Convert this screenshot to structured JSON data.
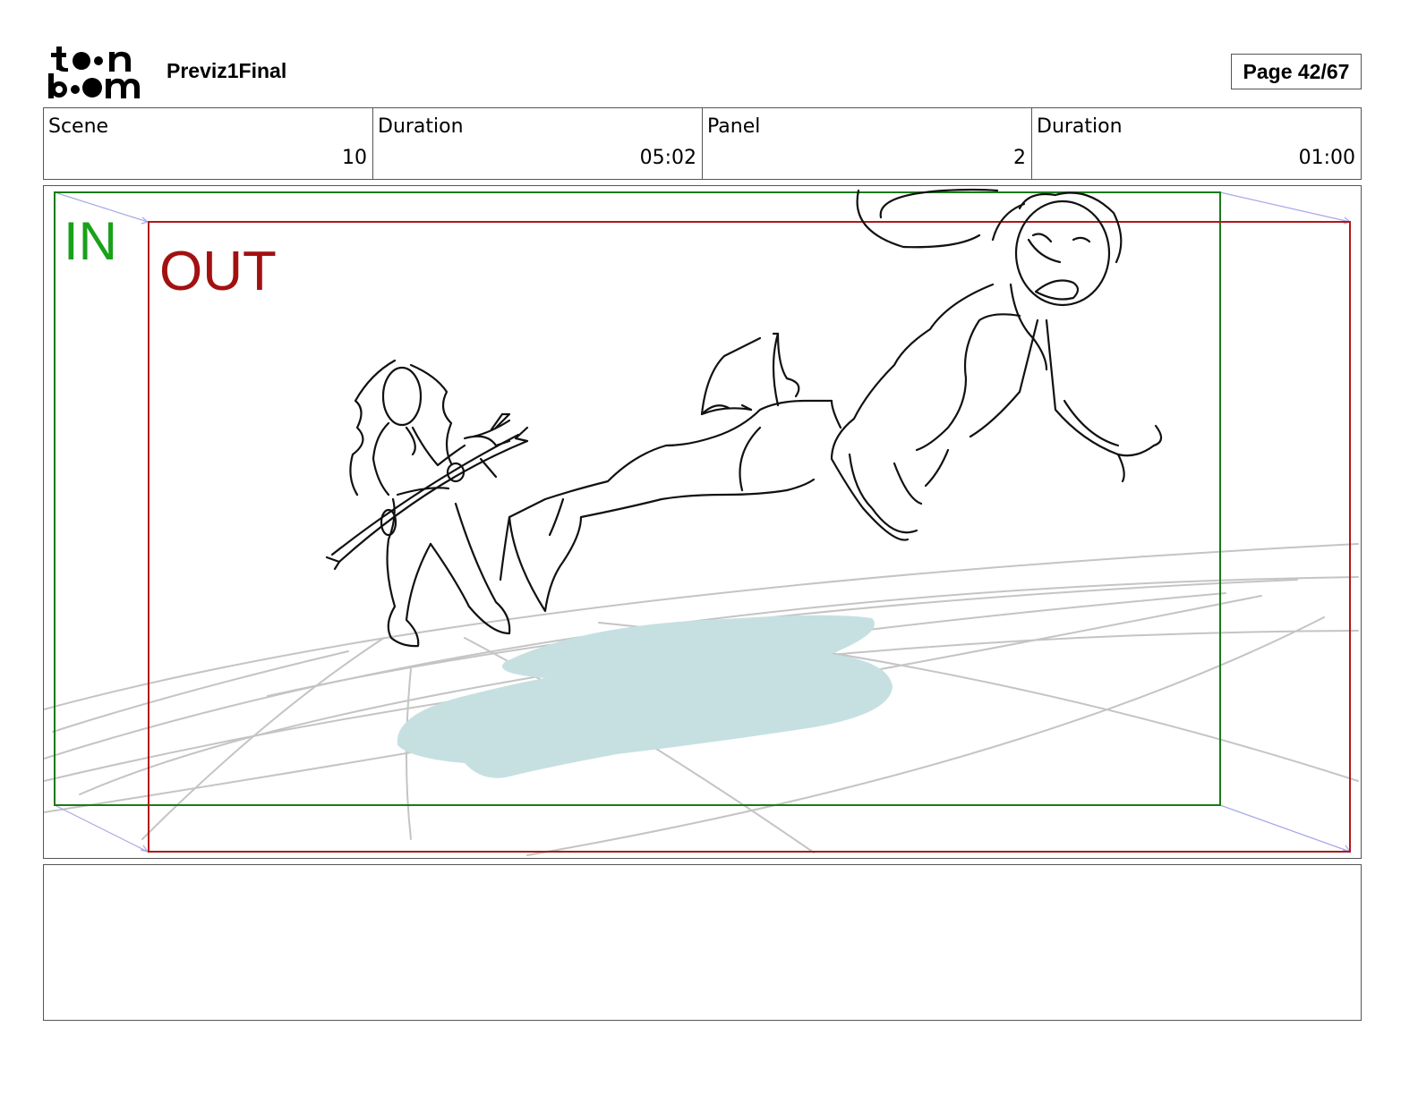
{
  "header": {
    "logo_text": "toon boom",
    "project_title": "Previz1Final",
    "page_counter": "Page 42/67"
  },
  "info": [
    {
      "label": "Scene",
      "value": "10"
    },
    {
      "label": "Duration",
      "value": "05:02"
    },
    {
      "label": "Panel",
      "value": "2"
    },
    {
      "label": "Duration",
      "value": "01:00"
    }
  ],
  "panel": {
    "in_label": "IN",
    "out_label": "OUT",
    "colors": {
      "in_frame": "#1a7a1a",
      "in_text": "#1aa11a",
      "out_frame": "#b01818",
      "out_text": "#a31010",
      "motion_guide": "#a8a8e8",
      "ground_lines": "#c4c4c4",
      "shadow": "#c6e0e2",
      "sketch": "#111111"
    }
  },
  "notes": {}
}
